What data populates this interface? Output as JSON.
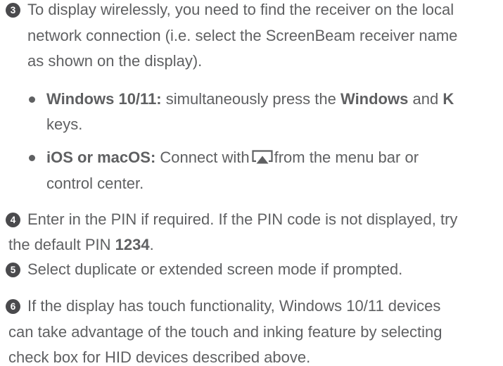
{
  "steps": [
    {
      "number": "3",
      "lines": [
        "To display wirelessly, you need to find the receiver on the local",
        "network connection (i.e. select the ScreenBeam receiver name",
        "as shown on the display)."
      ],
      "bullets": [
        {
          "label": "Windows 10/11:",
          "line1_text": "simultaneously press the",
          "key1": "Windows",
          "and_text": "and",
          "key2": "K",
          "line2": "keys."
        },
        {
          "label": "iOS or macOS:",
          "line1_before": "Connect with",
          "icon": "airplay-icon",
          "line1_after": "from the menu bar or",
          "line2": "control center."
        }
      ]
    },
    {
      "number": "4",
      "line1": "Enter in the PIN if required. If the PIN code is not displayed, try",
      "line2_before": "the default PIN",
      "pin": "1234",
      "line2_after": "."
    },
    {
      "number": "5",
      "line1": "Select duplicate or extended screen mode if prompted."
    },
    {
      "number": "6",
      "lines": [
        "If the display has touch functionality, Windows 10/11 devices",
        "can take advantage of the touch and inking feature by selecting",
        "check box for HID devices described above."
      ]
    }
  ],
  "colors": {
    "text": "#5f6062",
    "badge": "#4a4a4d"
  }
}
